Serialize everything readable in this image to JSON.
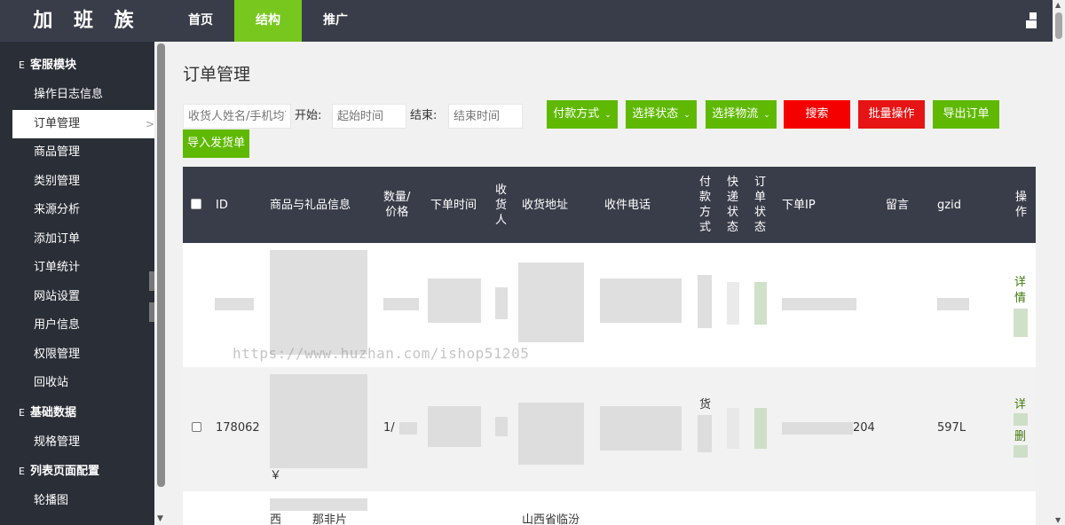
{
  "app": {
    "brand": "加 班 族"
  },
  "topnav": [
    {
      "label": "首页"
    },
    {
      "label": "结构",
      "active": true
    },
    {
      "label": "推广"
    }
  ],
  "sidebar": {
    "groups": [
      {
        "label": "客服模块",
        "icon": "list-icon",
        "items": [
          "操作日志信息",
          "订单管理",
          "商品管理",
          "类别管理",
          "来源分析",
          "添加订单",
          "订单统计",
          "网站设置",
          "用户信息",
          "权限管理",
          "回收站"
        ]
      },
      {
        "label": "基础数据",
        "icon": "list-icon",
        "items": [
          "规格管理"
        ]
      },
      {
        "label": "列表页面配置",
        "icon": "list-icon",
        "items": [
          "轮播图"
        ]
      }
    ],
    "active_item": "订单管理"
  },
  "page": {
    "title": "订单管理"
  },
  "toolbar": {
    "search_placeholder": "收货人姓名/手机均可",
    "start_label": "开始:",
    "start_placeholder": "起始时间",
    "end_label": "结束:",
    "end_placeholder": "结束时间",
    "pay_method": "付款方式",
    "status": "选择状态",
    "logistics": "选择物流",
    "search": "搜索",
    "batch": "批量操作",
    "export": "导出订单",
    "import": "导入发货单"
  },
  "table": {
    "headers": {
      "id": "ID",
      "goods": "商品与礼品信息",
      "qty_line1": "数量/",
      "qty_line2": "价格",
      "order_time": "下单时间",
      "receiver": [
        "收",
        "货",
        "人"
      ],
      "address": "收货地址",
      "phone": "收件电话",
      "pay": [
        "付",
        "款",
        "方",
        "式"
      ],
      "express": [
        "快",
        "递",
        "状",
        "态"
      ],
      "order_status": [
        "订",
        "单",
        "状",
        "态"
      ],
      "ip": "下单IP",
      "message": "留言",
      "gzid": "gzid",
      "action": [
        "操",
        "作"
      ]
    },
    "rows": [
      {
        "id": "",
        "detail": [
          "详",
          "情"
        ]
      },
      {
        "id": "178062",
        "qty": "1/",
        "pay": "货",
        "ip_tail": "204",
        "gzid_tail": "597L",
        "detail": [
          "详"
        ],
        "delete": "删",
        "goods_head": "￥"
      },
      {
        "goods_head": "西",
        "goods_tail": "那非片",
        "address": "山西省临汾"
      }
    ]
  },
  "watermark": "https://www.huzhan.com/ishop51205"
}
